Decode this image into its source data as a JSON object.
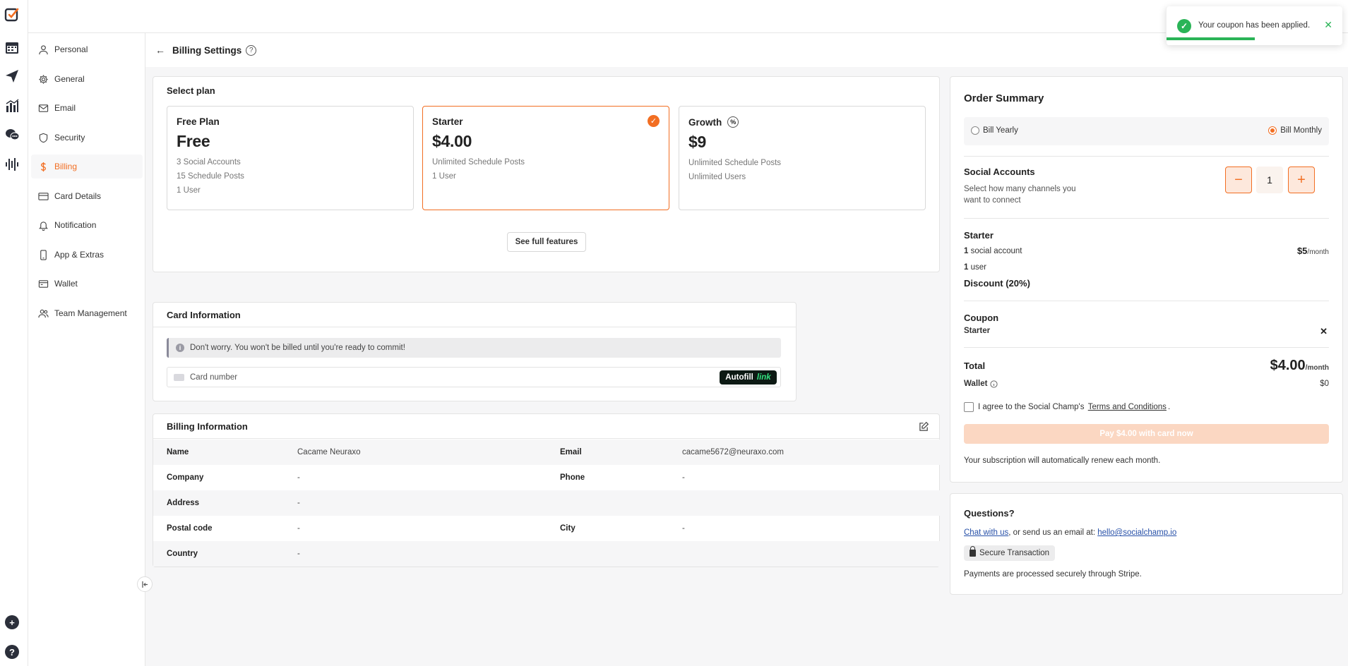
{
  "toast": {
    "message": "Your coupon has been applied.",
    "close": "✕",
    "progress": 0.5
  },
  "sidebar": {
    "items": [
      {
        "label": "Personal",
        "icon": "user-icon"
      },
      {
        "label": "General",
        "icon": "gear-icon"
      },
      {
        "label": "Email",
        "icon": "mail-icon"
      },
      {
        "label": "Security",
        "icon": "shield-icon"
      },
      {
        "label": "Billing",
        "icon": "dollar-icon"
      },
      {
        "label": "Card Details",
        "icon": "credit-card-icon"
      },
      {
        "label": "Notification",
        "icon": "bell-icon"
      },
      {
        "label": "App & Extras",
        "icon": "phone-icon"
      },
      {
        "label": "Wallet",
        "icon": "wallet-icon"
      },
      {
        "label": "Team Management",
        "icon": "team-icon"
      }
    ],
    "active": "Billing"
  },
  "header": {
    "back": "←",
    "title": "Billing Settings",
    "help": "?"
  },
  "select_plan": {
    "title": "Select plan",
    "plans": [
      {
        "name": "Free Plan",
        "price": "Free",
        "features": [
          "3 Social Accounts",
          "15 Schedule Posts",
          "1 User"
        ]
      },
      {
        "name": "Starter",
        "price": "$4.00",
        "features": [
          "Unlimited Schedule Posts",
          "1 User"
        ]
      },
      {
        "name": "Growth",
        "price": "$9",
        "features": [
          "Unlimited Schedule Posts",
          "Unlimited Users"
        ]
      }
    ],
    "selected": "Starter",
    "see_features": "See full features",
    "check_glyph": "✓",
    "percent_glyph": "%"
  },
  "card_info": {
    "title": "Card Information",
    "notice": "Don't worry. You won't be billed until you're ready to commit!",
    "notice_icon": "i",
    "card_placeholder": "Card number",
    "autofill": "Autofill",
    "autofill_link": "link"
  },
  "billing_info": {
    "title": "Billing Information",
    "rows": [
      {
        "label": "Name",
        "value": "Cacame Neuraxo",
        "label2": "Email",
        "value2": "cacame5672@neuraxo.com"
      },
      {
        "label": "Company",
        "value": "-",
        "label2": "Phone",
        "value2": "-"
      },
      {
        "label": "Address",
        "value": "-",
        "label2": "",
        "value2": ""
      },
      {
        "label": "Postal code",
        "value": "-",
        "label2": "City",
        "value2": "-"
      },
      {
        "label": "Country",
        "value": "-",
        "label2": "",
        "value2": ""
      }
    ]
  },
  "order_summary": {
    "title": "Order Summary",
    "bill_yearly": "Bill Yearly",
    "bill_monthly": "Bill Monthly",
    "billing_selected": "Bill Monthly",
    "social_accounts_title": "Social Accounts",
    "social_accounts_desc": "Select how many channels you want to connect",
    "quantity": "1",
    "minus": "−",
    "plus": "+",
    "plan_name": "Starter",
    "accounts_count": "1",
    "accounts_text": "social account",
    "users_count": "1",
    "users_text": "user",
    "line_price": "$5",
    "per_month": "/month",
    "discount": "Discount (20%)",
    "coupon_title": "Coupon",
    "coupon_code": "Starter",
    "coupon_remove": "✕",
    "total_label": "Total",
    "total_value": "$4.00",
    "wallet_label": "Wallet",
    "wallet_value": "$0",
    "agree_prefix": "I agree to the Social Champ's",
    "agree_link": "Terms and Conditions",
    "agree_suffix": ".",
    "pay_button": "Pay $4.00 with card now",
    "renew_note": "Your subscription will automatically renew each month."
  },
  "questions": {
    "title": "Questions?",
    "chat_link": "Chat with us",
    "mid_text": ", or send us an email at: ",
    "email_link": "hello@socialchamp.io",
    "secure": "Secure Transaction",
    "note": "Payments are processed securely through Stripe."
  },
  "rail": {
    "add_glyph": "+",
    "help_glyph": "?"
  },
  "colors": {
    "accent": "#f26e22",
    "success": "#2ab457",
    "link": "#2750a8"
  }
}
